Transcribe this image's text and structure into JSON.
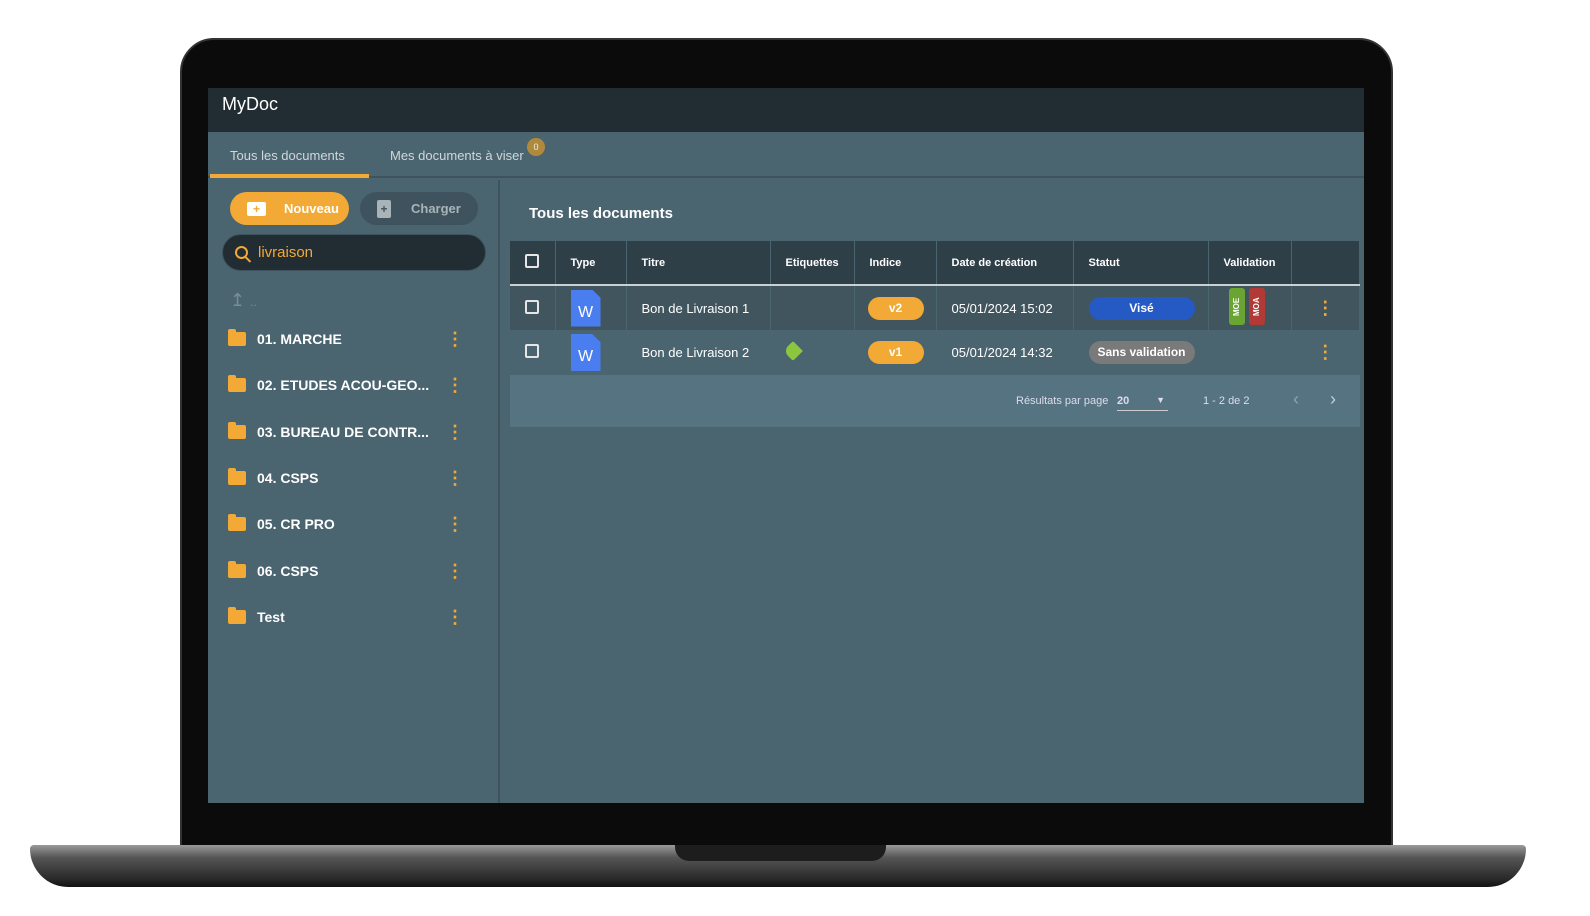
{
  "app": {
    "title": "MyDoc"
  },
  "tabs": [
    {
      "label": "Tous les documents",
      "active": true
    },
    {
      "label": "Mes documents à viser",
      "badge": "0"
    }
  ],
  "sidebar": {
    "new_label": "Nouveau",
    "upload_label": "Charger",
    "search": {
      "value": "livraison"
    },
    "up_label": "..",
    "folders": [
      {
        "label": "01. MARCHE"
      },
      {
        "label": "02. ETUDES ACOU-GEO..."
      },
      {
        "label": "03. BUREAU DE CONTR..."
      },
      {
        "label": "04. CSPS"
      },
      {
        "label": "05. CR PRO"
      },
      {
        "label": "06. CSPS"
      },
      {
        "label": "Test"
      }
    ]
  },
  "main": {
    "title": "Tous les documents",
    "columns": [
      "Type",
      "Titre",
      "Etiquettes",
      "Indice",
      "Date de création",
      "Statut",
      "Validation"
    ],
    "rows": [
      {
        "type": "W",
        "title": "Bon de Livraison 1",
        "tag": false,
        "indice": "v2",
        "date": "05/01/2024 15:02",
        "status": "Visé",
        "status_color": "#2559c4",
        "validation": [
          "MOE",
          "MOA"
        ]
      },
      {
        "type": "W",
        "title": "Bon de Livraison 2",
        "tag": true,
        "indice": "v1",
        "date": "05/01/2024 14:32",
        "status": "Sans validation",
        "status_color": "#7a7a7a",
        "validation": []
      }
    ],
    "pagination": {
      "per_page_label": "Résultats par page",
      "per_page": "20",
      "range": "1 - 2 de 2"
    }
  },
  "colors": {
    "accent": "#f3a935",
    "moe": "#6aa534",
    "moa": "#b23a36",
    "tag": "#8cc63f"
  }
}
